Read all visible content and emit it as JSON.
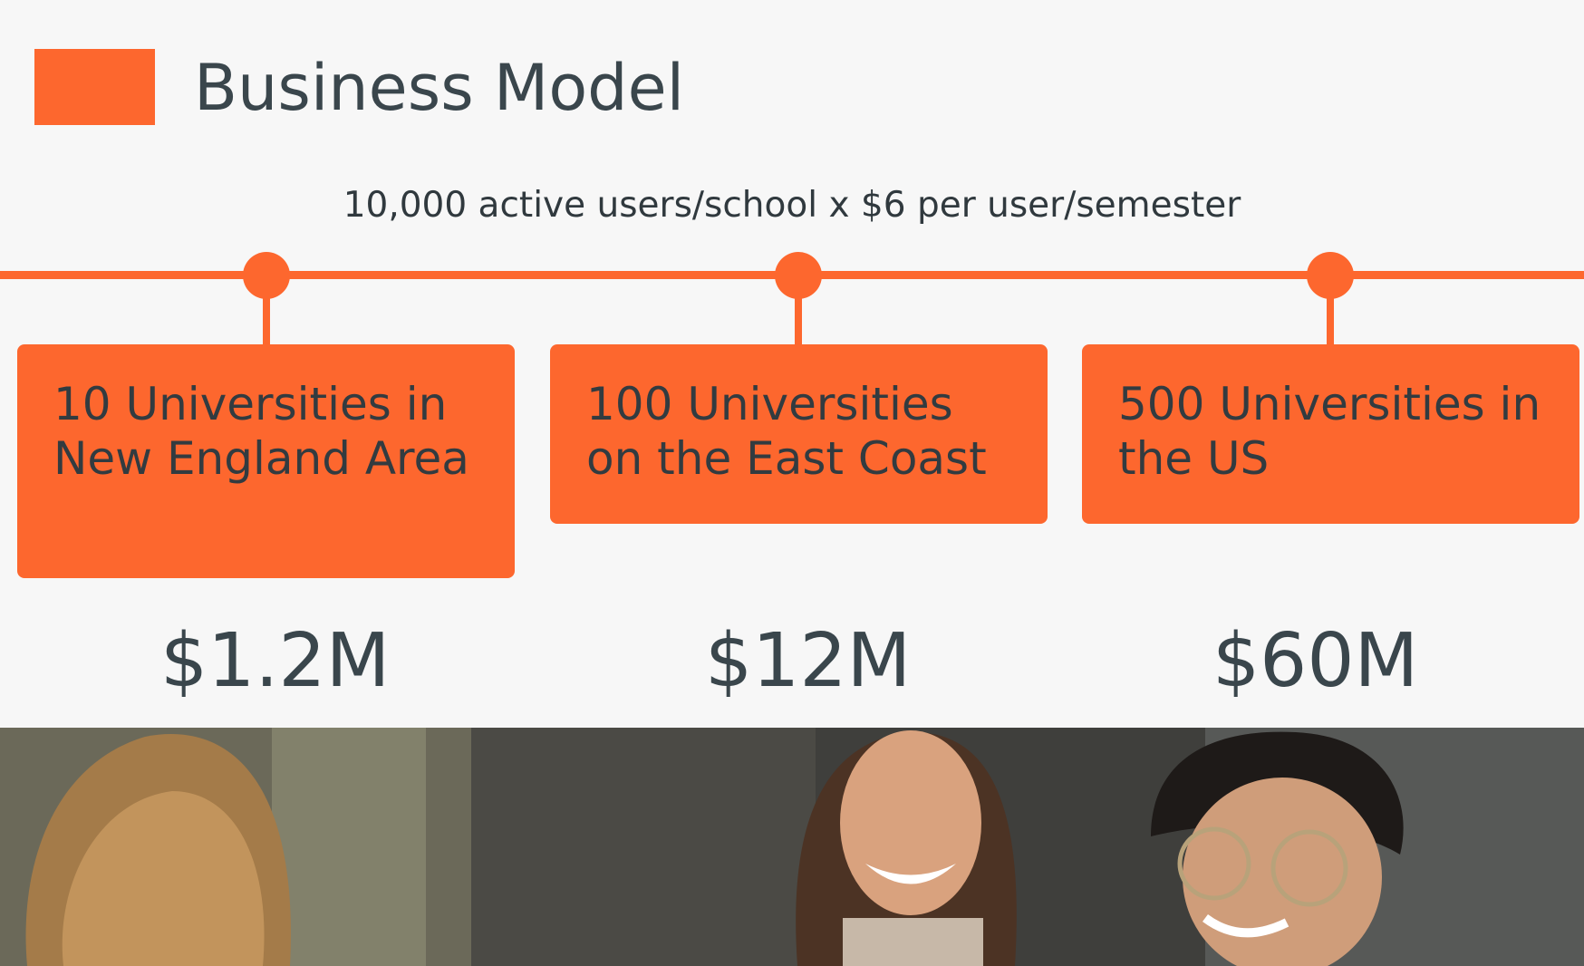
{
  "title": "Business Model",
  "formula": "10,000 active users/school x $6 per user/semester",
  "milestones": [
    {
      "label": "10 Universities in New England Area",
      "value": "$1.2M"
    },
    {
      "label": "100 Universities on the East Coast",
      "value": "$12M"
    },
    {
      "label": "500 Universities in the US",
      "value": "$60M"
    }
  ],
  "colors": {
    "accent": "#fd672e",
    "text": "#3a464c",
    "background": "#f7f7f7"
  }
}
